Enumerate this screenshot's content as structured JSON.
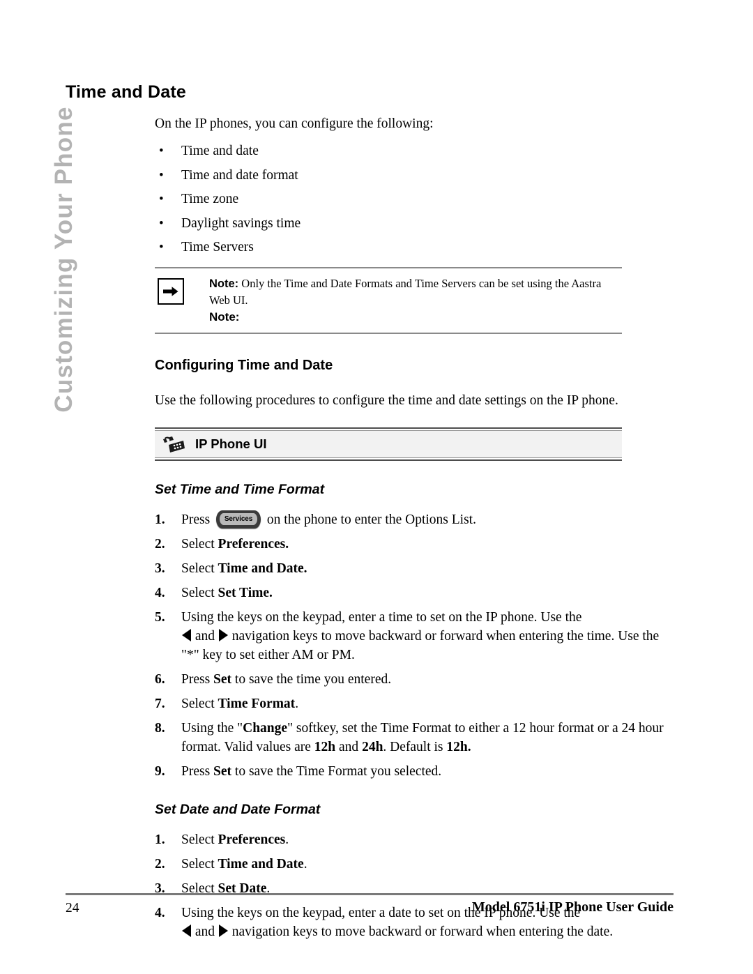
{
  "sidebar": {
    "running_head": "Customizing Your Phone",
    "color": "#b3b3b3"
  },
  "page_title": "Time and Date",
  "intro": "On the IP phones, you can configure the following:",
  "bullets": [
    "Time and date",
    "Time and date format",
    "Time zone",
    "Daylight savings time",
    "Time Servers"
  ],
  "note": {
    "icon": "right-arrow-icon",
    "label": "Note:",
    "text": "Only the Time and Date Formats and Time Servers can be set using the Aastra Web UI.",
    "extra_label": "Note:"
  },
  "configuring": {
    "heading": "Configuring Time and Date",
    "lead": "Use the following procedures to configure the time and date settings on the IP phone."
  },
  "ui_banner": {
    "icon": "desk-phone-icon",
    "label": "IP Phone UI"
  },
  "procedures": [
    {
      "title": "Set Time and Time Format",
      "steps": [
        {
          "num": "1.",
          "parts": [
            {
              "t": "text",
              "v": "Press "
            },
            {
              "t": "key",
              "v": "Services"
            },
            {
              "t": "text",
              "v": " on the phone to enter the Options List."
            }
          ]
        },
        {
          "num": "2.",
          "parts": [
            {
              "t": "text",
              "v": "Select "
            },
            {
              "t": "bold",
              "v": "Preferences."
            }
          ]
        },
        {
          "num": "3.",
          "parts": [
            {
              "t": "text",
              "v": "Select "
            },
            {
              "t": "bold",
              "v": "Time and Date."
            }
          ]
        },
        {
          "num": "4.",
          "parts": [
            {
              "t": "text",
              "v": "Select "
            },
            {
              "t": "bold",
              "v": "Set Time."
            }
          ]
        },
        {
          "num": "5.",
          "parts": [
            {
              "t": "text",
              "v": "Using the keys on the keypad, enter a time to set on the IP phone. Use the "
            },
            {
              "t": "break"
            },
            {
              "t": "arrow-left"
            },
            {
              "t": "text",
              "v": " and "
            },
            {
              "t": "arrow-right"
            },
            {
              "t": "text",
              "v": "  navigation keys to move backward or forward when entering the time. Use the \"*\" key to set either AM or PM."
            }
          ]
        },
        {
          "num": "6.",
          "parts": [
            {
              "t": "text",
              "v": "Press "
            },
            {
              "t": "bold",
              "v": "Set"
            },
            {
              "t": "text",
              "v": " to save the time you entered."
            }
          ]
        },
        {
          "num": "7.",
          "parts": [
            {
              "t": "text",
              "v": "Select "
            },
            {
              "t": "bold",
              "v": "Time Format"
            },
            {
              "t": "text",
              "v": "."
            }
          ]
        },
        {
          "num": "8.",
          "parts": [
            {
              "t": "text",
              "v": "Using the \""
            },
            {
              "t": "bold",
              "v": "Change"
            },
            {
              "t": "text",
              "v": "\" softkey, set the Time Format to either a 12 hour format or a 24 hour format. Valid values are "
            },
            {
              "t": "bold",
              "v": "12h"
            },
            {
              "t": "text",
              "v": " and "
            },
            {
              "t": "bold",
              "v": "24h"
            },
            {
              "t": "text",
              "v": ". Default is "
            },
            {
              "t": "bold",
              "v": "12h."
            }
          ]
        },
        {
          "num": "9.",
          "parts": [
            {
              "t": "text",
              "v": "Press "
            },
            {
              "t": "bold",
              "v": "Set"
            },
            {
              "t": "text",
              "v": " to save the Time Format you selected."
            }
          ]
        }
      ]
    },
    {
      "title": "Set Date and Date Format",
      "steps": [
        {
          "num": "1.",
          "parts": [
            {
              "t": "text",
              "v": "Select "
            },
            {
              "t": "bold",
              "v": "Preferences"
            },
            {
              "t": "text",
              "v": "."
            }
          ]
        },
        {
          "num": "2.",
          "parts": [
            {
              "t": "text",
              "v": "Select "
            },
            {
              "t": "bold",
              "v": "Time and Date"
            },
            {
              "t": "text",
              "v": "."
            }
          ]
        },
        {
          "num": "3.",
          "parts": [
            {
              "t": "text",
              "v": "Select "
            },
            {
              "t": "bold",
              "v": "Set Date"
            },
            {
              "t": "text",
              "v": "."
            }
          ]
        },
        {
          "num": "4.",
          "parts": [
            {
              "t": "text",
              "v": "Using the keys on the keypad, enter a date to set on the IP phone. Use the "
            },
            {
              "t": "break"
            },
            {
              "t": "arrow-left"
            },
            {
              "t": "text",
              "v": " and "
            },
            {
              "t": "arrow-right"
            },
            {
              "t": "text",
              "v": "  navigation keys to move backward or forward when entering the date."
            }
          ]
        }
      ]
    }
  ],
  "footer": {
    "page_number": "24",
    "guide_title": "Model 6751i IP Phone User Guide"
  }
}
